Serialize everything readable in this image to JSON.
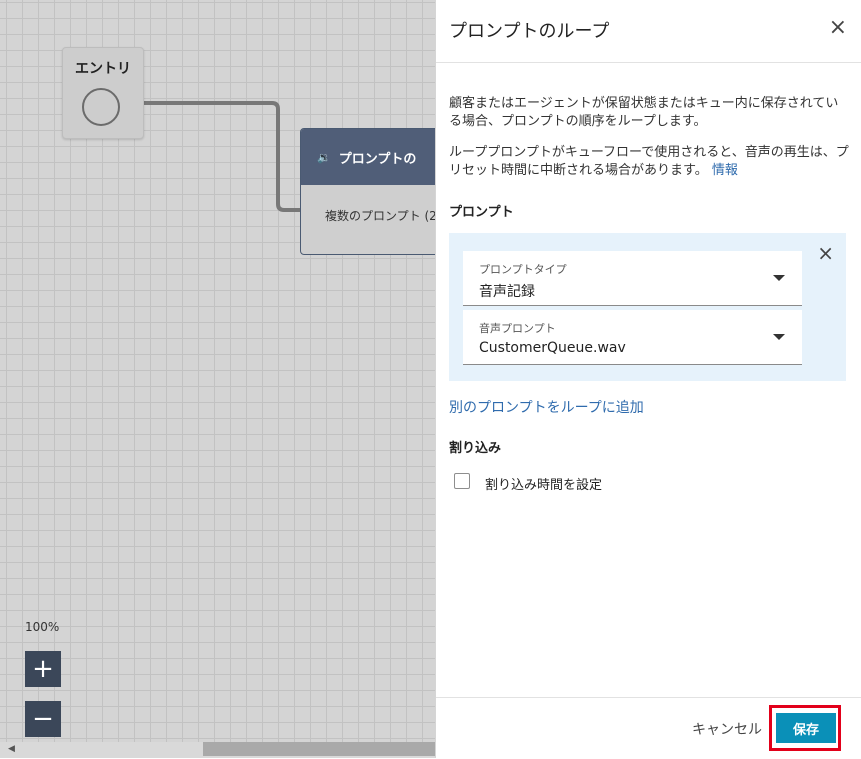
{
  "canvas": {
    "entry_node": {
      "title": "エントリ"
    },
    "prompt_node": {
      "title": "プロンプトの",
      "body": "複数のプロンプト (2"
    },
    "zoom": {
      "level": "100%",
      "zoom_in_label": "+",
      "zoom_out_label": "−"
    }
  },
  "panel": {
    "title": "プロンプトのループ",
    "close_label": "×",
    "description_1": "顧客またはエージェントが保留状態またはキュー内に保存されている場合、プロンプトの順序をループします。",
    "description_2": "ループプロンプトがキューフローで使用されると、音声の再生は、プリセット時間に中断される場合があります。",
    "info_link": "情報",
    "prompts_heading": "プロンプト",
    "prompt_item": {
      "remove_label": "×",
      "prompt_type": {
        "label": "プロンプトタイプ",
        "value": "音声記録"
      },
      "audio_prompt": {
        "label": "音声プロンプト",
        "value": "CustomerQueue.wav"
      }
    },
    "add_prompt_link": "別のプロンプトをループに追加",
    "barge_in_heading": "割り込み",
    "barge_in_checkbox_label": "割り込み時間を設定",
    "footer": {
      "cancel_label": "キャンセル",
      "save_label": "保存"
    }
  },
  "colors": {
    "primary": "#0a90b8",
    "link": "#2f6bad",
    "highlight": "#e2001a",
    "node_header": "#505e78"
  }
}
